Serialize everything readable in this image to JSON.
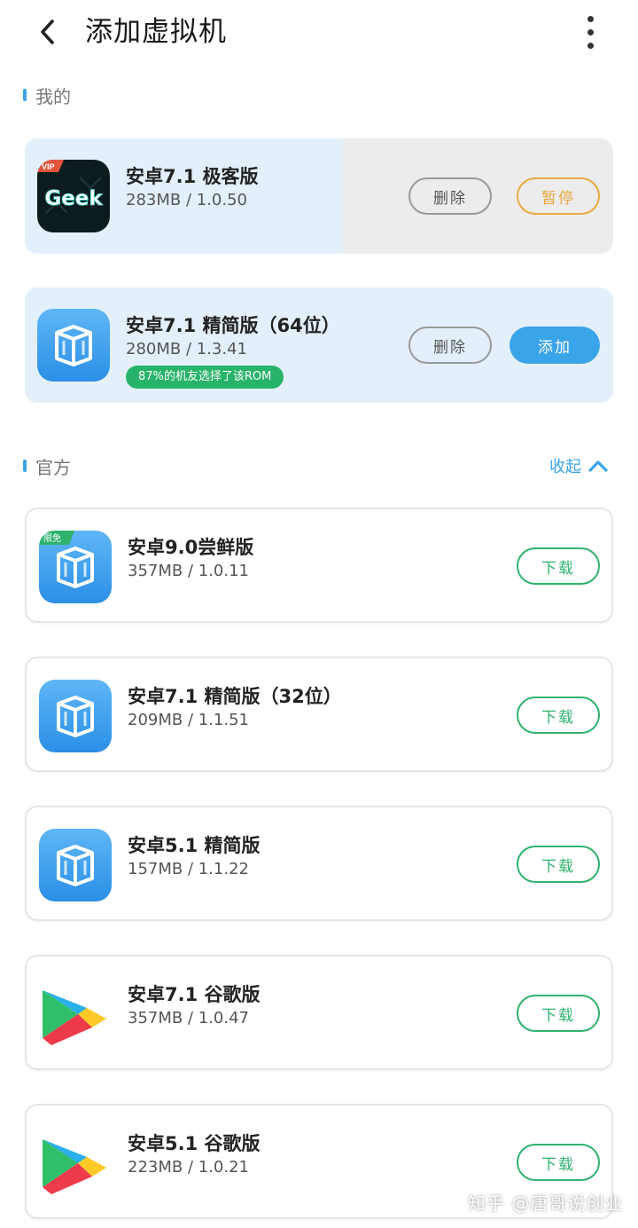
{
  "header": {
    "title": "添加虚拟机",
    "back_icon": "chevron-left-icon",
    "more_icon": "more-vertical-icon"
  },
  "sections": {
    "mine": {
      "title": "我的"
    },
    "official": {
      "title": "官方",
      "collapse_label": "收起",
      "collapse_icon": "chevron-up-icon"
    }
  },
  "mine_items": [
    {
      "name": "安卓7.1 极客版",
      "meta": "283MB / 1.0.50",
      "icon": "geek-icon",
      "icon_badge": "VIP",
      "icon_text": "Geek",
      "download_progress": 0.54,
      "delete_label": "删除",
      "action_label": "暂停"
    },
    {
      "name": "安卓7.1 精简版（64位）",
      "meta": "280MB / 1.3.41",
      "icon": "vm-cube-icon",
      "tag": "87%的机友选择了该ROM",
      "delete_label": "删除",
      "action_label": "添加"
    }
  ],
  "official_items": [
    {
      "name": "安卓9.0尝鲜版",
      "meta": "357MB / 1.0.11",
      "icon": "vm-cube-icon",
      "icon_badge": "限免",
      "action_label": "下载"
    },
    {
      "name": "安卓7.1 精简版（32位）",
      "meta": "209MB / 1.1.51",
      "icon": "vm-cube-icon",
      "action_label": "下载"
    },
    {
      "name": "安卓5.1 精简版",
      "meta": "157MB / 1.1.22",
      "icon": "vm-cube-icon",
      "action_label": "下载"
    },
    {
      "name": "安卓7.1 谷歌版",
      "meta": "357MB / 1.0.47",
      "icon": "google-play-icon",
      "action_label": "下载"
    },
    {
      "name": "安卓5.1 谷歌版",
      "meta": "223MB / 1.0.21",
      "icon": "google-play-icon",
      "action_label": "下载"
    }
  ],
  "watermark": "知乎 @唐哥说创业",
  "colors": {
    "accent_blue": "#3aa4e8",
    "download_green": "#2fb36e",
    "pause_orange": "#e9a93f",
    "tag_green": "#27b369"
  }
}
